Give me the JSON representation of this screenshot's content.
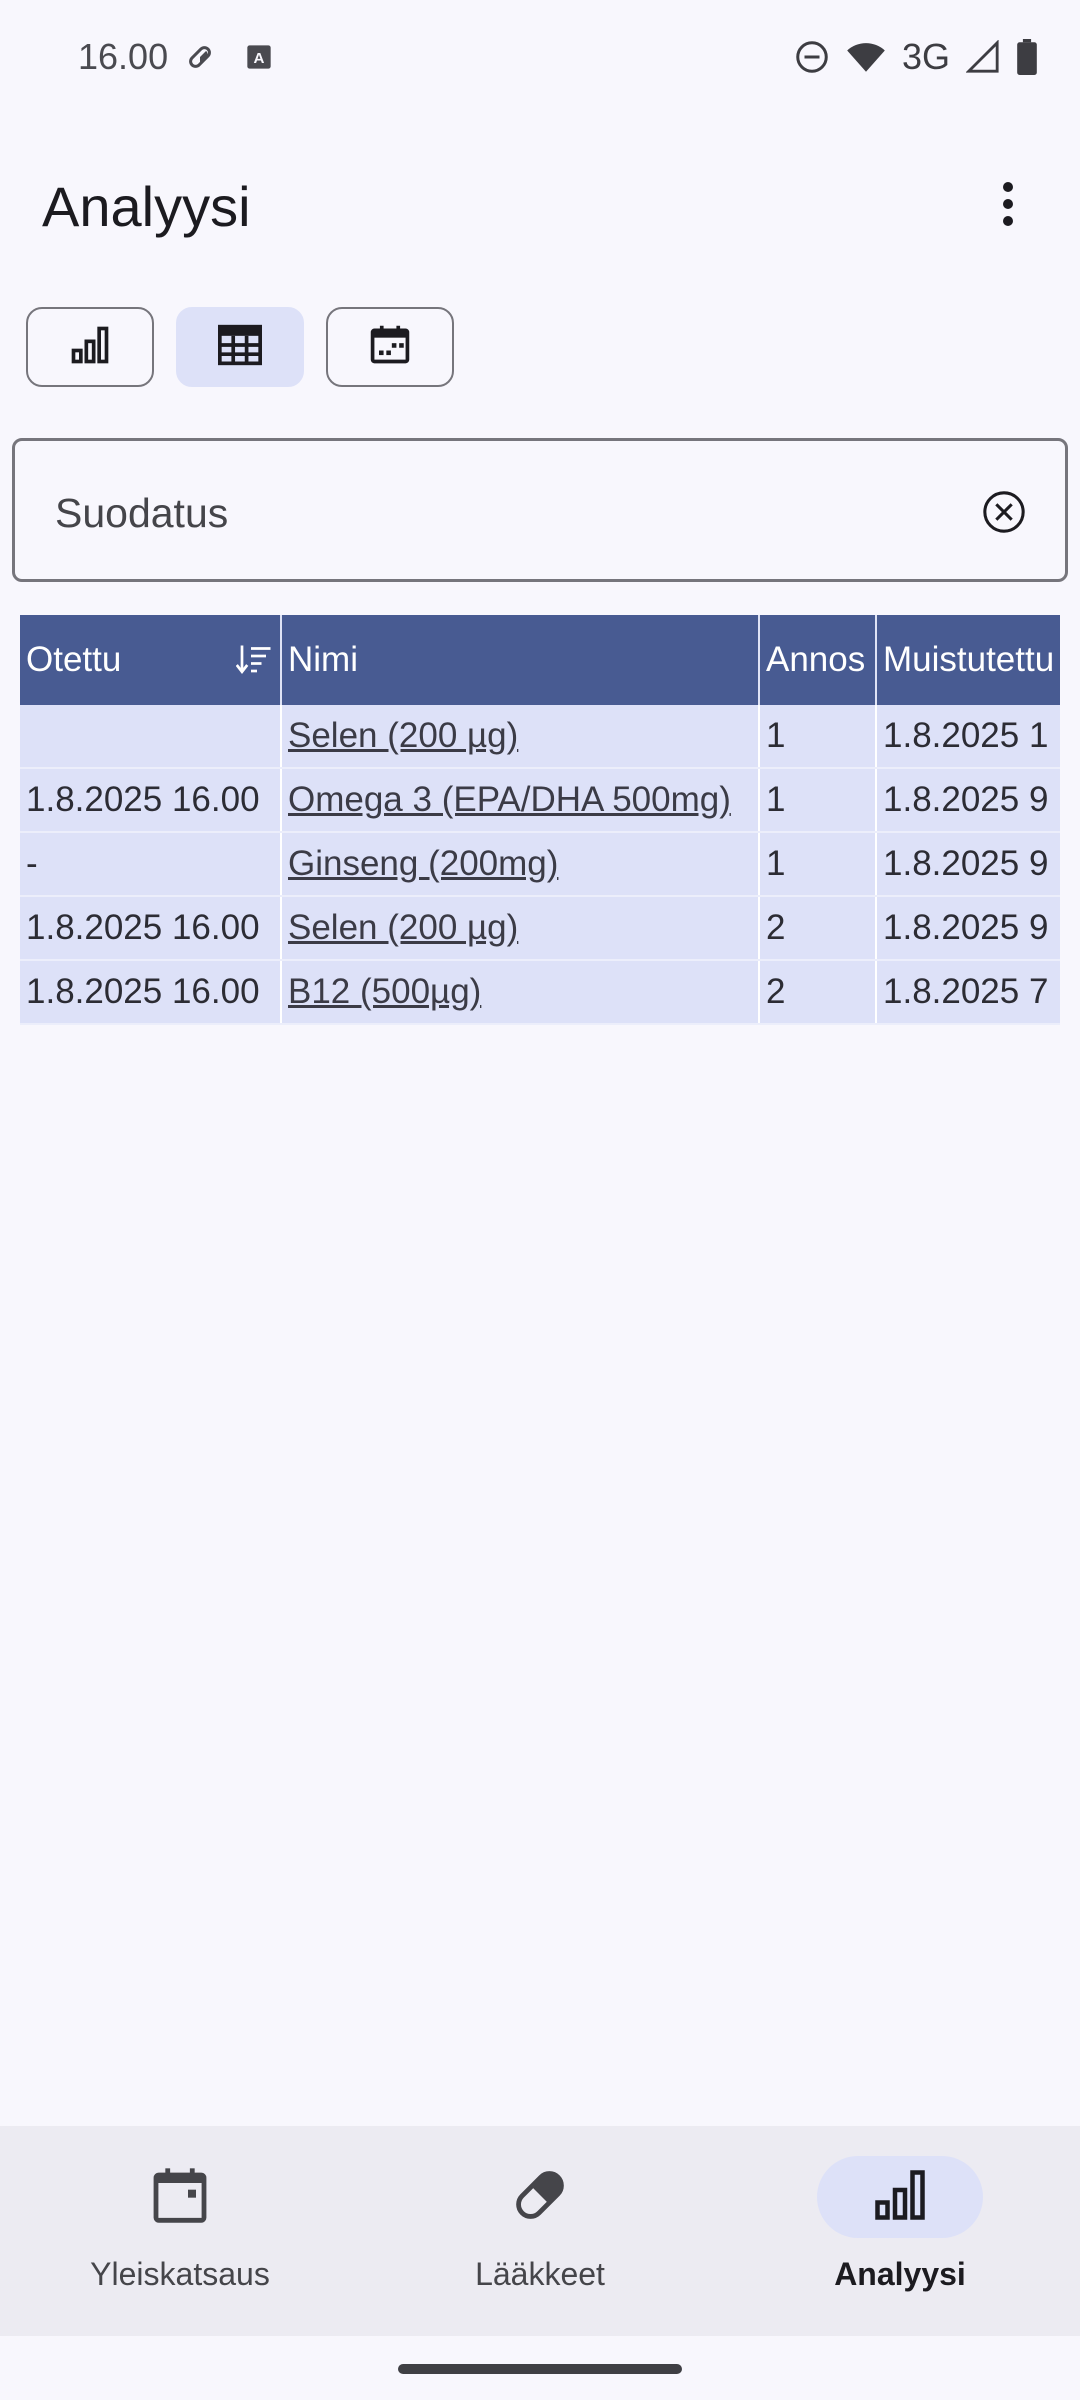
{
  "status_bar": {
    "time": "16.00",
    "network": "3G",
    "icons": [
      "pill-icon",
      "text-app-icon",
      "dnd-icon",
      "wifi-icon",
      "signal-icon",
      "battery-icon"
    ]
  },
  "app_bar": {
    "title": "Analyysi",
    "menu_icon": "more-vert-icon"
  },
  "view_toggles": [
    {
      "icon": "bar-chart-icon",
      "selected": false
    },
    {
      "icon": "table-icon",
      "selected": true
    },
    {
      "icon": "calendar-icon",
      "selected": false
    }
  ],
  "filter": {
    "placeholder": "Suodatus",
    "value": ""
  },
  "table": {
    "columns": [
      "Otettu",
      "Nimi",
      "Annos",
      "Muistutettu"
    ],
    "rows": [
      [
        "",
        "Selen (200 µg)",
        "1",
        "1.8.2025 1"
      ],
      [
        "1.8.2025 16.00",
        "Omega 3 (EPA/DHA 500mg)",
        "1",
        "1.8.2025 9"
      ],
      [
        "-",
        "Ginseng (200mg)",
        "1",
        "1.8.2025 9"
      ],
      [
        "1.8.2025 16.00",
        "Selen (200 µg)",
        "2",
        "1.8.2025 9"
      ],
      [
        "1.8.2025 16.00",
        "B12 (500µg)",
        "2",
        "1.8.2025 7"
      ]
    ]
  },
  "bottom_nav": {
    "items": [
      {
        "label": "Yleiskatsaus",
        "icon": "calendar-icon",
        "active": false
      },
      {
        "label": "Lääkkeet",
        "icon": "pill-icon",
        "active": false
      },
      {
        "label": "Analyysi",
        "icon": "bar-chart-icon",
        "active": true
      }
    ]
  },
  "colors": {
    "header": "#485b92",
    "row": "#dde1f8",
    "accent_container": "#dde1f8",
    "background": "#f8f7fd"
  }
}
